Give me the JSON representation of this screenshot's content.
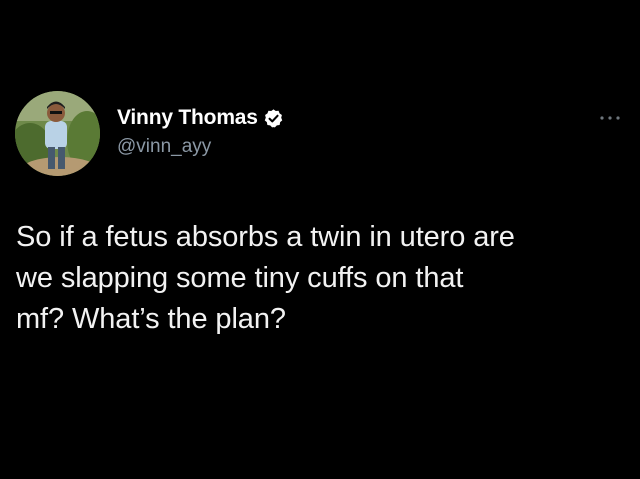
{
  "tweet": {
    "author": {
      "display_name": "Vinny Thomas",
      "handle": "@vinn_ayy",
      "verified": true
    },
    "text": "So if a fetus absorbs a twin in utero are\nwe slapping some tiny cuffs on that\nmf? What’s the plan?",
    "menu_icon": "more-dots-icon"
  },
  "colors": {
    "background": "#000000",
    "name": "#ffffff",
    "handle": "#8b98a5",
    "text": "#f2f2f2",
    "verified_badge": "#ffffff"
  }
}
